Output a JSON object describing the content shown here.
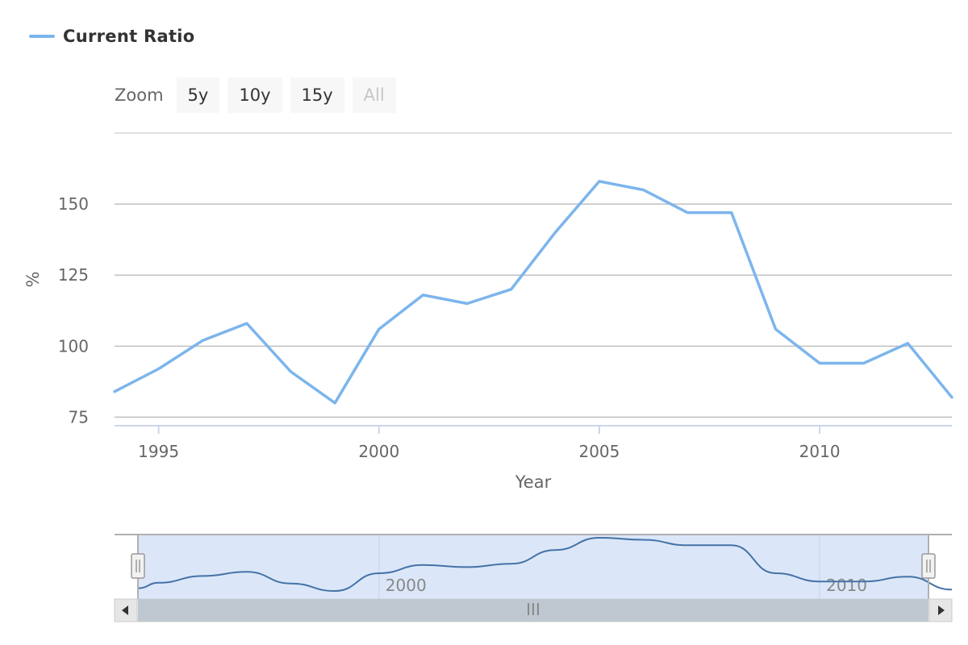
{
  "legend": {
    "series_name": "Current Ratio",
    "color": "#7cb5ec"
  },
  "zoom": {
    "label": "Zoom",
    "buttons": [
      {
        "label": "5y",
        "enabled": true
      },
      {
        "label": "10y",
        "enabled": true
      },
      {
        "label": "15y",
        "enabled": true
      },
      {
        "label": "All",
        "enabled": false
      }
    ]
  },
  "navigator": {
    "tick_labels": [
      "2000",
      "2010"
    ],
    "scrollbar_grip": "III"
  },
  "chart_data": {
    "type": "line",
    "xlabel": "Year",
    "ylabel": "%",
    "x_ticks": [
      1995,
      2000,
      2005,
      2010
    ],
    "y_ticks": [
      75,
      100,
      125,
      150
    ],
    "xlim": [
      1994,
      2013
    ],
    "ylim": [
      72,
      175
    ],
    "grid": true,
    "legend_position": "top-left",
    "series": [
      {
        "name": "Current Ratio",
        "color": "#7cb5ec",
        "x": [
          1994,
          1995,
          1996,
          1997,
          1998,
          1999,
          2000,
          2001,
          2002,
          2003,
          2004,
          2005,
          2006,
          2007,
          2008,
          2009,
          2010,
          2011,
          2012,
          2013
        ],
        "values": [
          84,
          92,
          102,
          108,
          91,
          80,
          106,
          118,
          115,
          120,
          140,
          158,
          155,
          147,
          147,
          106,
          94,
          94,
          101,
          82
        ]
      }
    ]
  }
}
